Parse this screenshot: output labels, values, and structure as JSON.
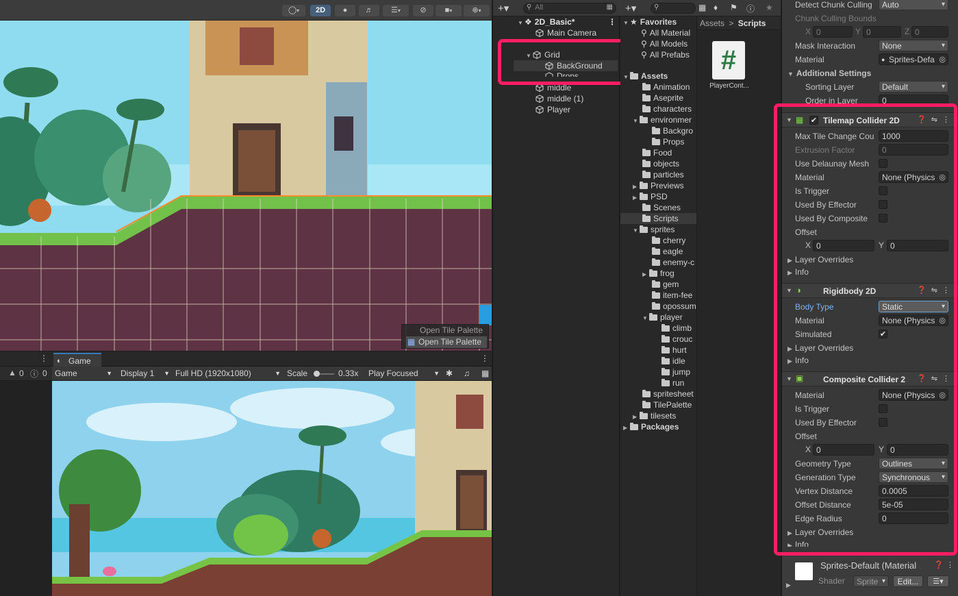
{
  "scene_view": {
    "toolbar": {
      "mode_2d": "2D"
    },
    "palette_overlay": {
      "label_back": "Open Tile Palette",
      "label_front": "Open Tile Palette"
    }
  },
  "game_view": {
    "tab_label": "Game",
    "console_counts": {
      "warnings": "0",
      "errors": "0"
    },
    "toolbar": {
      "view_select": "Game",
      "display": "Display 1",
      "resolution": "Full HD (1920x1080)",
      "scale_label": "Scale",
      "scale_value": "0.33x",
      "play_mode": "Play Focused"
    }
  },
  "hierarchy": {
    "items": [
      {
        "label": "2D_Basic*"
      },
      {
        "label": "Main Camera"
      },
      {
        "label": "Grid"
      },
      {
        "label": "BackGround"
      },
      {
        "label": "Drops"
      },
      {
        "label": "middle"
      },
      {
        "label": "middle (1)"
      },
      {
        "label": "Player"
      }
    ]
  },
  "project": {
    "search_placeholder": "",
    "favorites": {
      "label": "Favorites",
      "items": [
        "All Material",
        "All Models",
        "All Prefabs"
      ]
    },
    "assets_label": "Assets",
    "folders": [
      {
        "label": "Animation"
      },
      {
        "label": "Aseprite"
      },
      {
        "label": "characters"
      },
      {
        "label": "environmer"
      },
      {
        "label": "Backgro"
      },
      {
        "label": "Props"
      },
      {
        "label": "Food"
      },
      {
        "label": "objects"
      },
      {
        "label": "particles"
      },
      {
        "label": "Previews"
      },
      {
        "label": "PSD"
      },
      {
        "label": "Scenes"
      },
      {
        "label": "Scripts"
      },
      {
        "label": "sprites"
      },
      {
        "label": "cherry"
      },
      {
        "label": "eagle"
      },
      {
        "label": "enemy-c"
      },
      {
        "label": "frog"
      },
      {
        "label": "gem"
      },
      {
        "label": "item-fee"
      },
      {
        "label": "opossum"
      },
      {
        "label": "player"
      },
      {
        "label": "climb"
      },
      {
        "label": "crouc"
      },
      {
        "label": "hurt"
      },
      {
        "label": "idle"
      },
      {
        "label": "jump"
      },
      {
        "label": "run"
      },
      {
        "label": "spritesheet"
      },
      {
        "label": "TilePalette"
      },
      {
        "label": "tilesets"
      }
    ],
    "packages_label": "Packages",
    "breadcrumb": {
      "root": "Assets",
      "sep": ">",
      "current": "Scripts"
    },
    "asset": {
      "name": "PlayerCont...",
      "glyph": "#"
    }
  },
  "inspector": {
    "renderer": {
      "detect_chunk_culling": {
        "label": "Detect Chunk Culling",
        "value": "Auto"
      },
      "chunk_culling_bounds": {
        "label": "Chunk Culling Bounds",
        "x": "0",
        "y": "0",
        "z": "0"
      },
      "mask_interaction": {
        "label": "Mask Interaction",
        "value": "None"
      },
      "material": {
        "label": "Material",
        "value": "Sprites-Defa"
      },
      "additional_settings": "Additional Settings",
      "sorting_layer": {
        "label": "Sorting Layer",
        "value": "Default"
      },
      "order_in_layer": {
        "label": "Order in Layer",
        "value": "0"
      }
    },
    "tilemap_collider": {
      "title": "Tilemap Collider 2D",
      "max_tile_change": {
        "label": "Max Tile Change Cou",
        "value": "1000"
      },
      "extrusion_factor": {
        "label": "Extrusion Factor",
        "value": "0"
      },
      "use_delaunay": {
        "label": "Use Delaunay Mesh"
      },
      "material": {
        "label": "Material",
        "value": "None (Physics"
      },
      "is_trigger": {
        "label": "Is Trigger"
      },
      "used_by_effector": {
        "label": "Used By Effector"
      },
      "used_by_composite": {
        "label": "Used By Composite"
      },
      "offset": {
        "label": "Offset",
        "x": "0",
        "y": "0"
      },
      "layer_overrides": "Layer Overrides",
      "info": "Info"
    },
    "rigidbody": {
      "title": "Rigidbody 2D",
      "body_type": {
        "label": "Body Type",
        "value": "Static"
      },
      "material": {
        "label": "Material",
        "value": "None (Physics"
      },
      "simulated": {
        "label": "Simulated",
        "checked": "✔"
      },
      "layer_overrides": "Layer Overrides",
      "info": "Info"
    },
    "composite_collider": {
      "title": "Composite Collider 2",
      "material": {
        "label": "Material",
        "value": "None (Physics"
      },
      "is_trigger": {
        "label": "Is Trigger"
      },
      "used_by_effector": {
        "label": "Used By Effector"
      },
      "offset": {
        "label": "Offset",
        "x": "0",
        "y": "0"
      },
      "geometry_type": {
        "label": "Geometry Type",
        "value": "Outlines"
      },
      "generation_type": {
        "label": "Generation Type",
        "value": "Synchronous"
      },
      "vertex_distance": {
        "label": "Vertex Distance",
        "value": "0.0005"
      },
      "offset_distance": {
        "label": "Offset Distance",
        "value": "5e-05"
      },
      "edge_radius": {
        "label": "Edge Radius",
        "value": "0"
      },
      "layer_overrides": "Layer Overrides",
      "info": "Info"
    },
    "material_preview": {
      "title": "Sprites-Default (Material",
      "shader_label": "Shader",
      "shader_value": "Sprite",
      "edit_button": "Edit..."
    }
  },
  "colors": {
    "highlight": "#ff1d63",
    "selection_blue": "#7fb3ef",
    "panel_bg": "#383838"
  }
}
